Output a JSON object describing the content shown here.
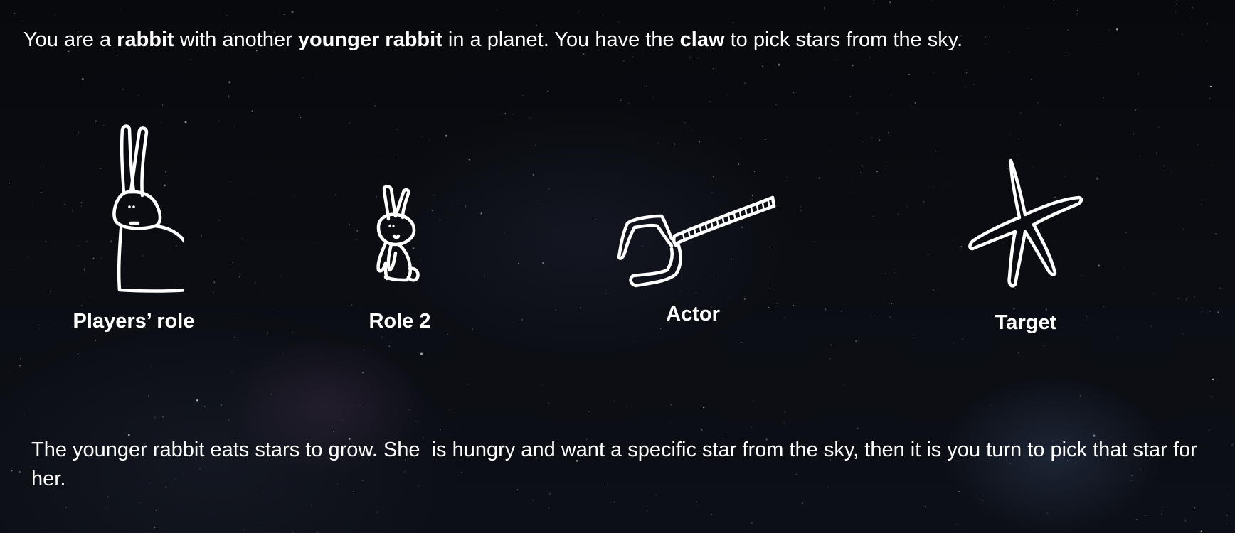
{
  "intro": {
    "p1": "You are a ",
    "b1": "rabbit",
    "p2": " with another ",
    "b2": "younger rabbit",
    "p3": " in a planet. You have the ",
    "b3": "claw",
    "p4": " to pick stars from the sky."
  },
  "roles": [
    {
      "label": "Players’ role",
      "icon": "rabbit-icon"
    },
    {
      "label": "Role 2",
      "icon": "young-rabbit-icon"
    },
    {
      "label": "Actor",
      "icon": "claw-icon"
    },
    {
      "label": "Target",
      "icon": "star-icon"
    }
  ],
  "outro": {
    "text": "The younger rabbit eats stars to grow. She  is hungry and want a specific star from the sky, then it is you turn to pick that star for her."
  },
  "colors": {
    "background": "#0b0d13",
    "text": "#ffffff"
  }
}
